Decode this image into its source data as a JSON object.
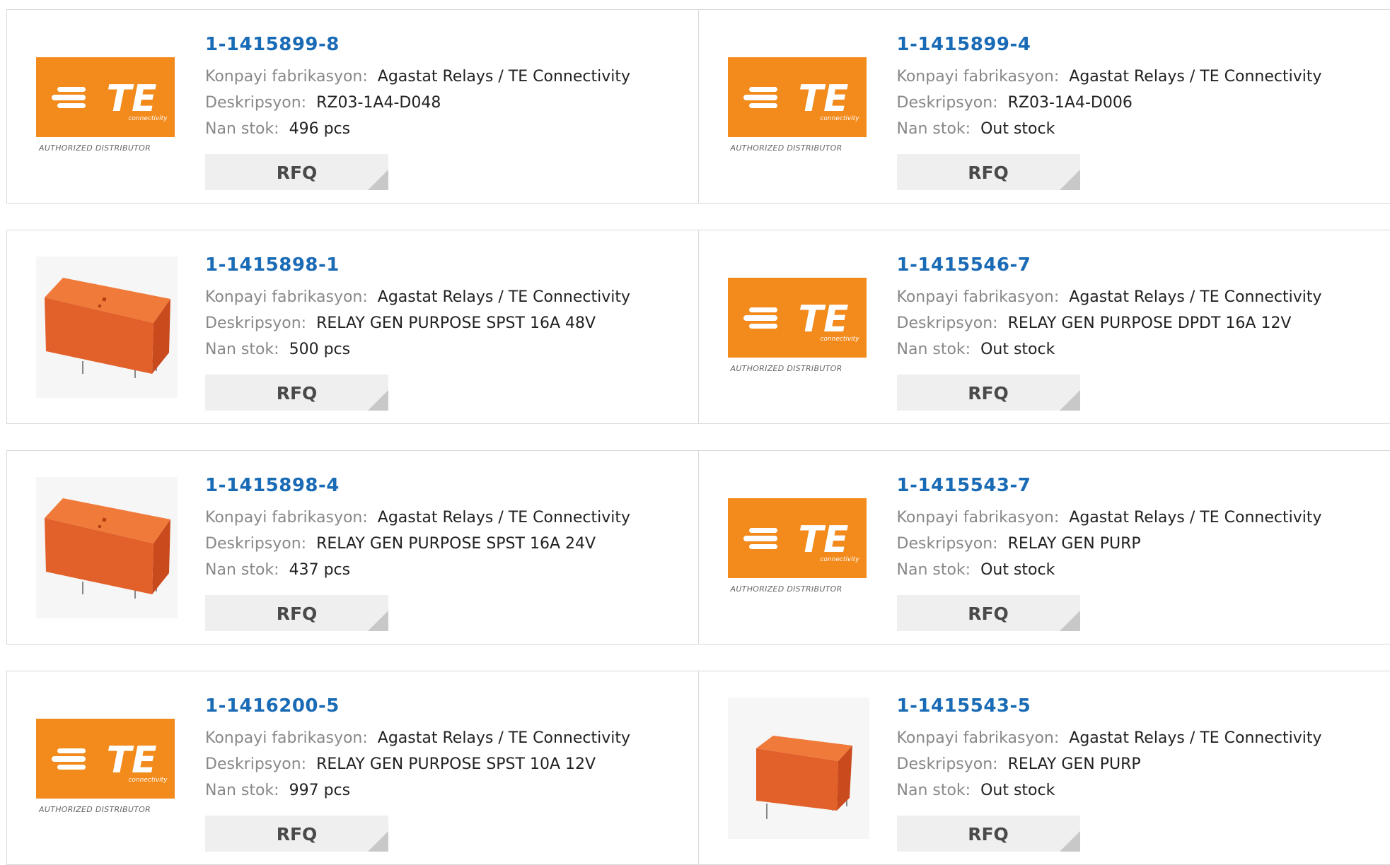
{
  "labels": {
    "manufacturer": "Konpayi fabrikasyon:",
    "description": "Deskripsyon:",
    "stock": "Nan stok:",
    "rfq": "RFQ"
  },
  "logo": {
    "wordmark": "TE",
    "tagline": "connectivity",
    "badge": "AUTHORIZED DISTRIBUTOR",
    "color": "#f28a1c"
  },
  "products": [
    {
      "part": "1-1415899-8",
      "manufacturer": "Agastat Relays / TE Connectivity",
      "description": "RZ03-1A4-D048",
      "stock": "496 pcs",
      "image": "te-logo"
    },
    {
      "part": "1-1415899-4",
      "manufacturer": "Agastat Relays / TE Connectivity",
      "description": "RZ03-1A4-D006",
      "stock": "Out stock",
      "image": "te-logo"
    },
    {
      "part": "1-1415898-1",
      "manufacturer": "Agastat Relays / TE Connectivity",
      "description": "RELAY GEN PURPOSE SPST 16A 48V",
      "stock": "500 pcs",
      "image": "relay-photo"
    },
    {
      "part": "1-1415546-7",
      "manufacturer": "Agastat Relays / TE Connectivity",
      "description": "RELAY GEN PURPOSE DPDT 16A 12V",
      "stock": "Out stock",
      "image": "te-logo"
    },
    {
      "part": "1-1415898-4",
      "manufacturer": "Agastat Relays / TE Connectivity",
      "description": "RELAY GEN PURPOSE SPST 16A 24V",
      "stock": "437 pcs",
      "image": "relay-photo"
    },
    {
      "part": "1-1415543-7",
      "manufacturer": "Agastat Relays / TE Connectivity",
      "description": "RELAY GEN PURP",
      "stock": "Out stock",
      "image": "te-logo"
    },
    {
      "part": "1-1416200-5",
      "manufacturer": "Agastat Relays / TE Connectivity",
      "description": "RELAY GEN PURPOSE SPST 10A 12V",
      "stock": "997 pcs",
      "image": "te-logo"
    },
    {
      "part": "1-1415543-5",
      "manufacturer": "Agastat Relays / TE Connectivity",
      "description": "RELAY GEN PURP",
      "stock": "Out stock",
      "image": "relay-photo-small"
    }
  ]
}
